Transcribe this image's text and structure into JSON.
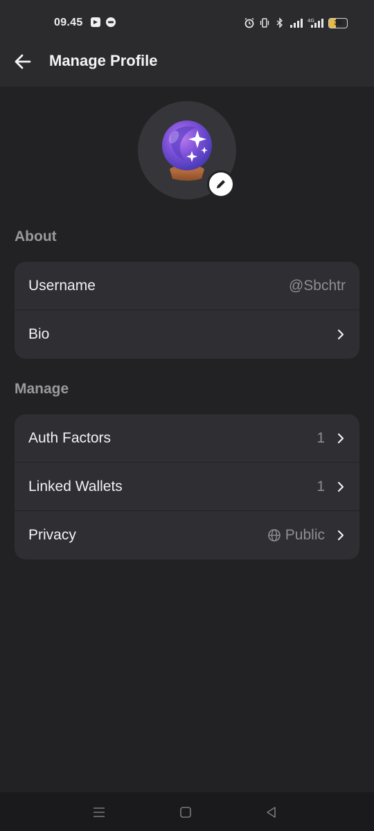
{
  "status_bar": {
    "time": "09.45",
    "battery": "38",
    "icons": [
      "notification-app-icon",
      "message-icon",
      "alarm-icon",
      "vibrate-icon",
      "bluetooth-icon",
      "signal-icon",
      "4g-signal-icon",
      "battery-icon"
    ]
  },
  "header": {
    "title": "Manage Profile"
  },
  "avatar": {
    "icon": "crystal-ball-icon",
    "edit_icon": "pencil-icon"
  },
  "about": {
    "label": "About",
    "rows": [
      {
        "label": "Username",
        "value": "@Sbchtr"
      },
      {
        "label": "Bio"
      }
    ]
  },
  "manage": {
    "label": "Manage",
    "rows": [
      {
        "label": "Auth Factors",
        "value": "1"
      },
      {
        "label": "Linked Wallets",
        "value": "1"
      },
      {
        "label": "Privacy",
        "value": "Public",
        "icon": "globe-icon"
      }
    ]
  },
  "colors": {
    "background": "#222224",
    "header": "#2b2b2e",
    "card": "#2e2e33",
    "muted_text": "#8e8e93"
  },
  "navigation_bar": [
    "menu-icon",
    "home-square-icon",
    "back-triangle-icon"
  ]
}
